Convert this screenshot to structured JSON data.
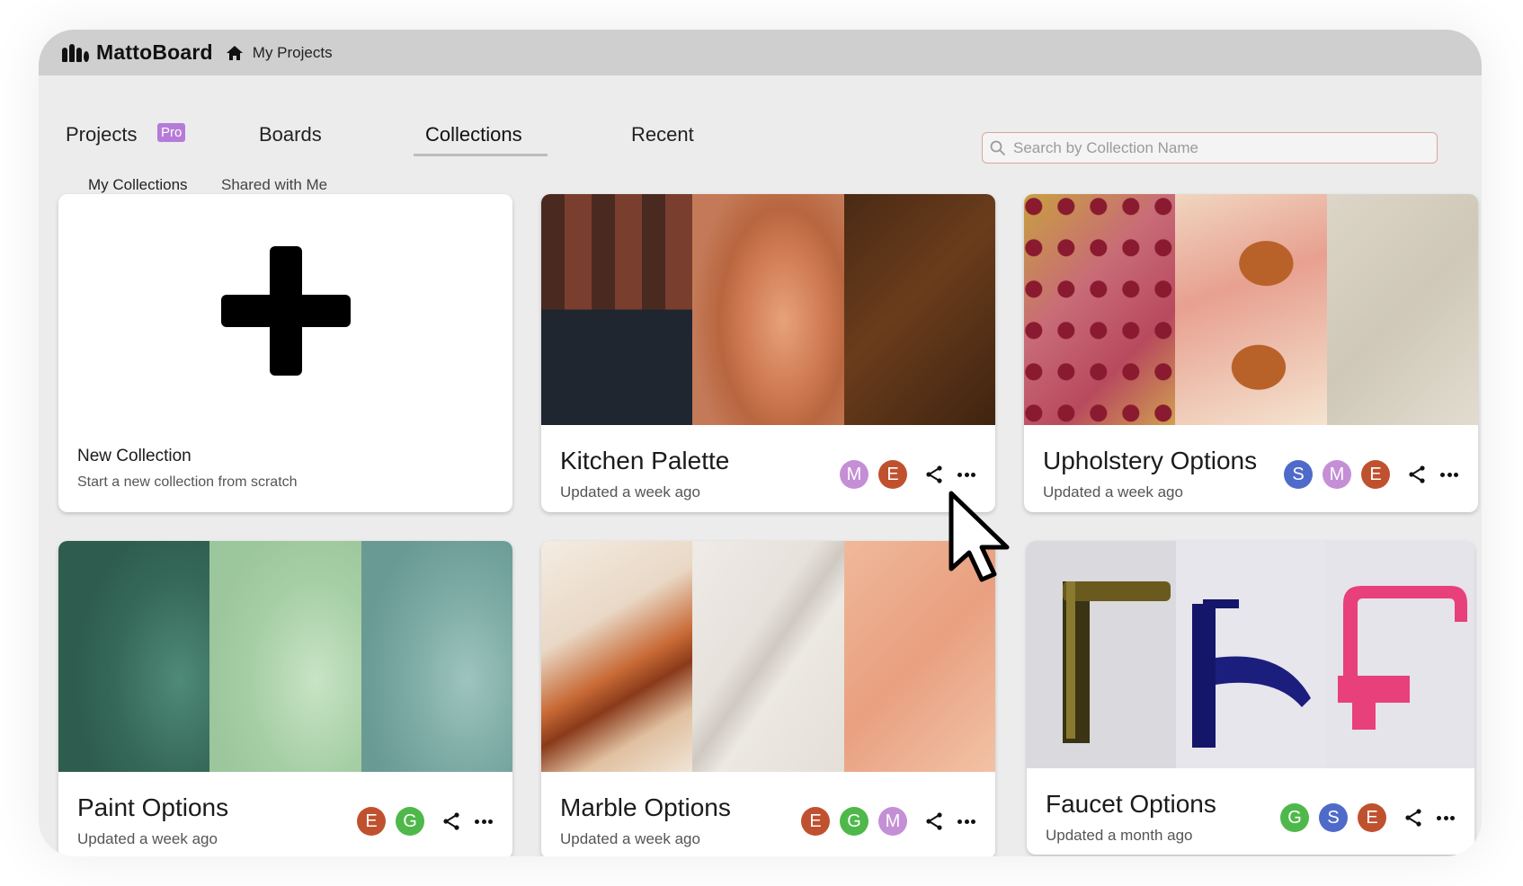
{
  "app": {
    "brand": "MattoBoard",
    "breadcrumb": "My Projects"
  },
  "tabs": [
    {
      "label": "Projects",
      "badge": "Pro"
    },
    {
      "label": "Boards"
    },
    {
      "label": "Collections",
      "active": true
    },
    {
      "label": "Recent"
    }
  ],
  "subtabs": [
    {
      "label": "My Collections"
    },
    {
      "label": "Shared with Me",
      "active": true
    }
  ],
  "search": {
    "placeholder": "Search by Collection Name",
    "value": ""
  },
  "new_collection": {
    "title": "New Collection",
    "subtitle": "Start a new collection from scratch"
  },
  "collections": [
    {
      "title": "Kitchen Palette",
      "updated": "Updated a week ago",
      "avatars": [
        {
          "letter": "M",
          "color": "#c58fd6"
        },
        {
          "letter": "E",
          "color": "#c0512f"
        }
      ],
      "swatches": [
        "stripes-brown",
        "terracotta-bowl",
        "brown-velvet"
      ]
    },
    {
      "title": "Upholstery Options",
      "updated": "Updated a week ago",
      "avatars": [
        {
          "letter": "S",
          "color": "#4f6bc9"
        },
        {
          "letter": "M",
          "color": "#c58fd6"
        },
        {
          "letter": "E",
          "color": "#c0512f"
        }
      ],
      "swatches": [
        "pink-pattern",
        "peach-leaf",
        "cream-texture"
      ]
    },
    {
      "title": "Paint Options",
      "updated": "Updated a week ago",
      "avatars": [
        {
          "letter": "E",
          "color": "#c0512f"
        },
        {
          "letter": "G",
          "color": "#4fb84a"
        }
      ],
      "swatches": [
        "dark-green",
        "mint",
        "sage"
      ]
    },
    {
      "title": "Marble Options",
      "updated": "Updated a week ago",
      "avatars": [
        {
          "letter": "E",
          "color": "#c0512f"
        },
        {
          "letter": "G",
          "color": "#4fb84a"
        },
        {
          "letter": "M",
          "color": "#c58fd6"
        }
      ],
      "swatches": [
        "orange-marble",
        "white-marble",
        "peach-marble"
      ]
    },
    {
      "title": "Faucet Options",
      "updated": "Updated a month ago",
      "avatars": [
        {
          "letter": "G",
          "color": "#4fb84a"
        },
        {
          "letter": "S",
          "color": "#4f6bc9"
        },
        {
          "letter": "E",
          "color": "#c0512f"
        }
      ],
      "swatches": [
        "gold-faucet",
        "navy-faucet",
        "pink-faucet"
      ]
    }
  ]
}
